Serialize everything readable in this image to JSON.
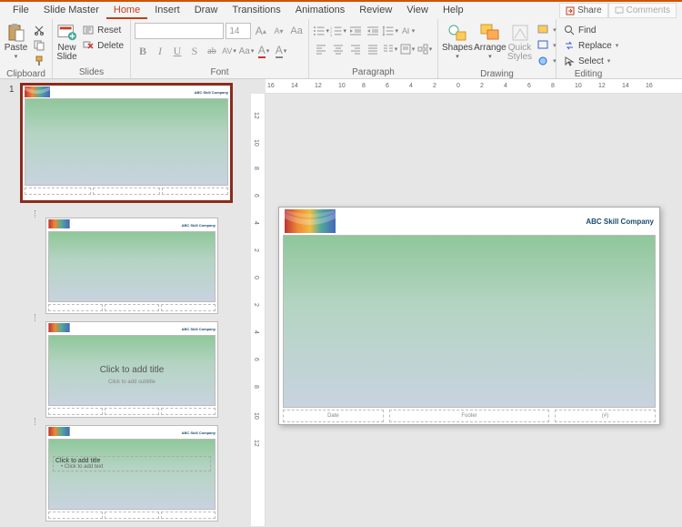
{
  "menu": {
    "tabs": [
      "File",
      "Slide Master",
      "Home",
      "Insert",
      "Draw",
      "Transitions",
      "Animations",
      "Review",
      "View",
      "Help"
    ],
    "active": 2,
    "share": "Share",
    "comments": "Comments"
  },
  "ribbon": {
    "clipboard": {
      "label": "Clipboard",
      "paste": "Paste"
    },
    "slides": {
      "label": "Slides",
      "newSlide": "New\nSlide",
      "reset": "Reset",
      "delete": "Delete"
    },
    "font": {
      "label": "Font",
      "fontName": "",
      "fontSize": "14",
      "btns": {
        "incr": "A",
        "decr": "A",
        "clear": "Aa",
        "b": "B",
        "i": "I",
        "u": "U",
        "s": "S",
        "ab": "ab",
        "av": "AV",
        "aa": "Aa",
        "color": "A",
        "hilite": "A"
      }
    },
    "paragraph": {
      "label": "Paragraph"
    },
    "drawing": {
      "label": "Drawing",
      "shapes": "Shapes",
      "arrange": "Arrange",
      "quick": "Quick\nStyles"
    },
    "editing": {
      "label": "Editing",
      "find": "Find",
      "replace": "Replace",
      "select": "Select"
    }
  },
  "thumbs": {
    "num1": "1"
  },
  "slide": {
    "company": "ABC Skill Company",
    "companyShort": "ABC Skill Company",
    "title": "Click to add title",
    "subtitle": "Click to add subtitle",
    "bullet": "Click to add text",
    "date": "Date",
    "footer": "Footer",
    "pg": "(#)"
  },
  "ruler": {
    "h": [
      "16",
      "14",
      "12",
      "10",
      "8",
      "6",
      "4",
      "2",
      "0",
      "2",
      "4",
      "6",
      "8",
      "10",
      "12",
      "14",
      "16"
    ],
    "v": [
      "12",
      "10",
      "8",
      "6",
      "4",
      "2",
      "0",
      "2",
      "4",
      "6",
      "8",
      "10",
      "12"
    ]
  }
}
